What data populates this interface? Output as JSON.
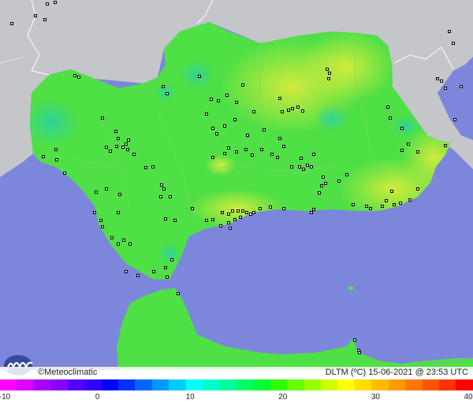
{
  "map": {
    "colors": {
      "sea": "#7c86db",
      "foreign_land": "#c4c6ca",
      "land_base": "#4fe046",
      "land_warm": "#b6ea40",
      "land_cool": "#2fd68a"
    },
    "icons": [
      "station-marker-icon",
      "meteoclimatic-logo-icon"
    ]
  },
  "footer": {
    "brand": "©Meteoclimatic",
    "product": "DLTM (ºC)",
    "datetime": "15-06-2021 @ 23:53 UTC"
  },
  "legend": {
    "tick_labels": [
      "-10",
      "0",
      "10",
      "20",
      "30",
      "40"
    ],
    "tick_values": [
      -10,
      0,
      10,
      20,
      30,
      40
    ],
    "min": -10,
    "max": 40,
    "colors": [
      "#ff00ff",
      "#dd00ff",
      "#aa00ff",
      "#8800ff",
      "#5500ff",
      "#3300ff",
      "#0000ff",
      "#0033ff",
      "#0066ff",
      "#0099ff",
      "#00ccff",
      "#00ffff",
      "#00ffcc",
      "#00ff99",
      "#00ff66",
      "#00ff33",
      "#33ff00",
      "#66ff00",
      "#99ff00",
      "#ccff00",
      "#ffff00",
      "#ffdd00",
      "#ffbb00",
      "#ff9900",
      "#ff7700",
      "#ff5500",
      "#ff3300",
      "#ff0000"
    ]
  }
}
